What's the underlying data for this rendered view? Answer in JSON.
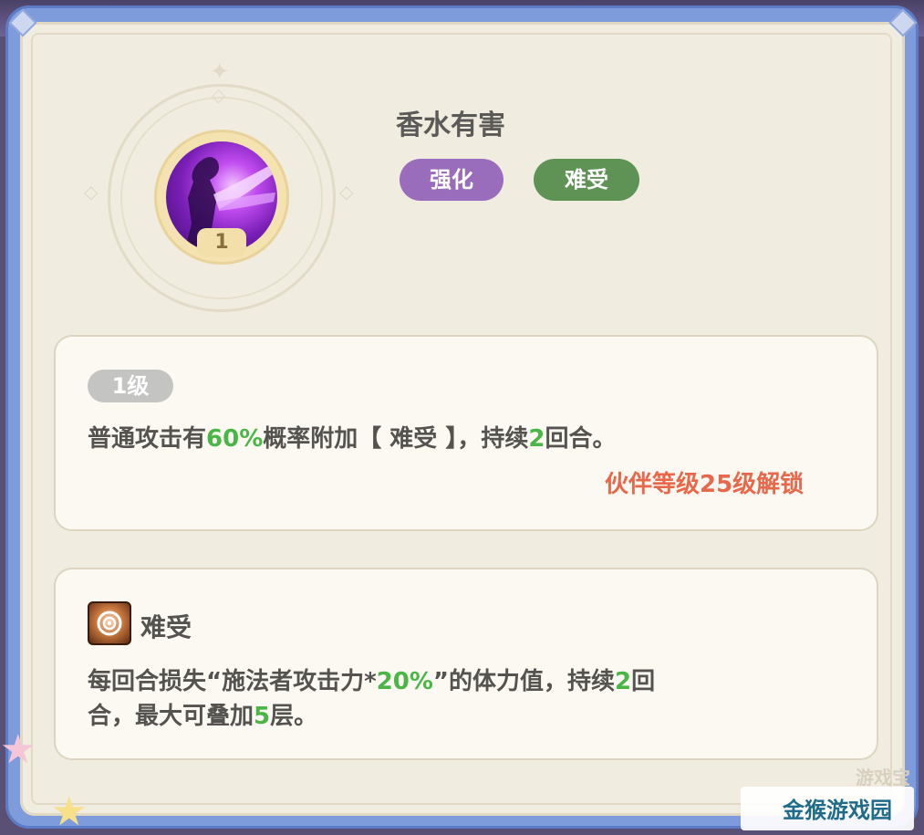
{
  "skill": {
    "title": "香水有害",
    "level_badge": "1",
    "tags": [
      "强化",
      "难受"
    ]
  },
  "level_card": {
    "level_label": "1级",
    "description_parts": [
      "普通攻击有",
      "60%",
      "概率附加【 难受 】，持续",
      "2",
      "回合。"
    ],
    "unlock_text": "伙伴等级25级解锁"
  },
  "effect_card": {
    "effect_name": "难受",
    "line1_parts": [
      "每回合损失“施法者攻击力*",
      "20%",
      "”的体力值，持续",
      "2",
      "回"
    ],
    "line2_parts": [
      "合，最大可叠加",
      "5",
      "层。"
    ]
  },
  "watermarks": {
    "top": "游戏宝",
    "logo": "金猴游戏园"
  },
  "colors": {
    "highlight": "#49b645",
    "unlock": "#e7684a",
    "tag_purple": "#9a6dbc",
    "tag_green": "#5f9255",
    "frame": "#7e9bdc"
  },
  "icons": {
    "skill_icon": "purple-silhouette-skill-icon",
    "effect_icon": "spiral-debuff-icon"
  }
}
